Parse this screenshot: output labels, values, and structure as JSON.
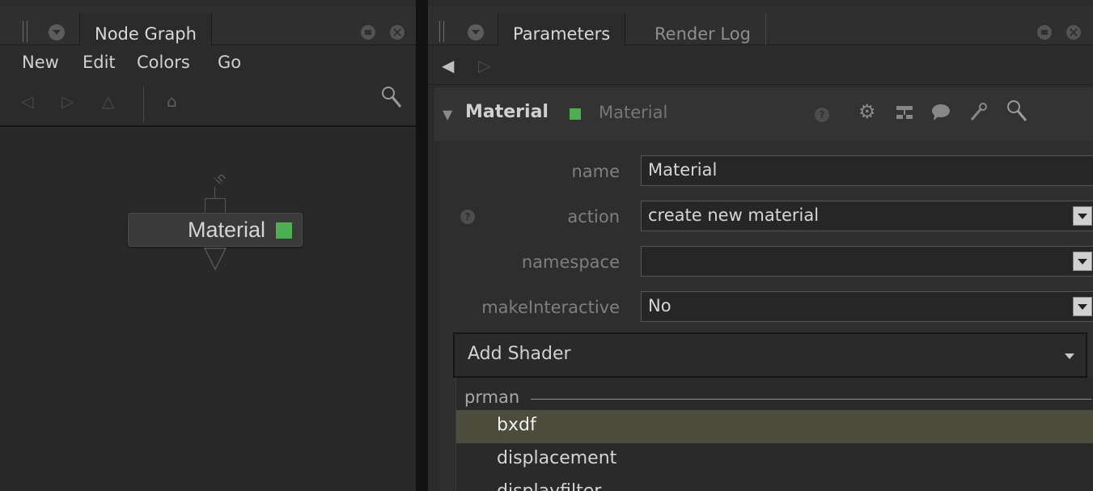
{
  "left_panel": {
    "tab_title": "Node Graph",
    "menu": [
      "New",
      "Edit",
      "Colors",
      "Go"
    ],
    "toolbar_icons": [
      "back-arrow-icon",
      "forward-arrow-icon",
      "up-arrow-icon",
      "home-icon",
      "search-icon"
    ],
    "node": {
      "name": "Material",
      "port_label": "in",
      "flag_color": "#4caf50"
    }
  },
  "right_panel": {
    "tabs": [
      "Parameters",
      "Render Log"
    ],
    "node_header": {
      "name": "Material",
      "type": "Material",
      "flag_color": "#4caf50",
      "icons": [
        "help-icon",
        "gear-icon",
        "hierarchy-icon",
        "comment-icon",
        "wrench-icon",
        "search-icon"
      ]
    },
    "params": {
      "name": {
        "label": "name",
        "value": "Material"
      },
      "action": {
        "label": "action",
        "value": "create new material"
      },
      "namespace": {
        "label": "namespace",
        "value": ""
      },
      "make_interactive": {
        "label": "makeInteractive",
        "value": "No"
      }
    },
    "add_shader": {
      "label": "Add Shader",
      "group": "prman",
      "items": [
        "bxdf",
        "displacement",
        "displayfilter"
      ],
      "selected": "bxdf"
    }
  }
}
